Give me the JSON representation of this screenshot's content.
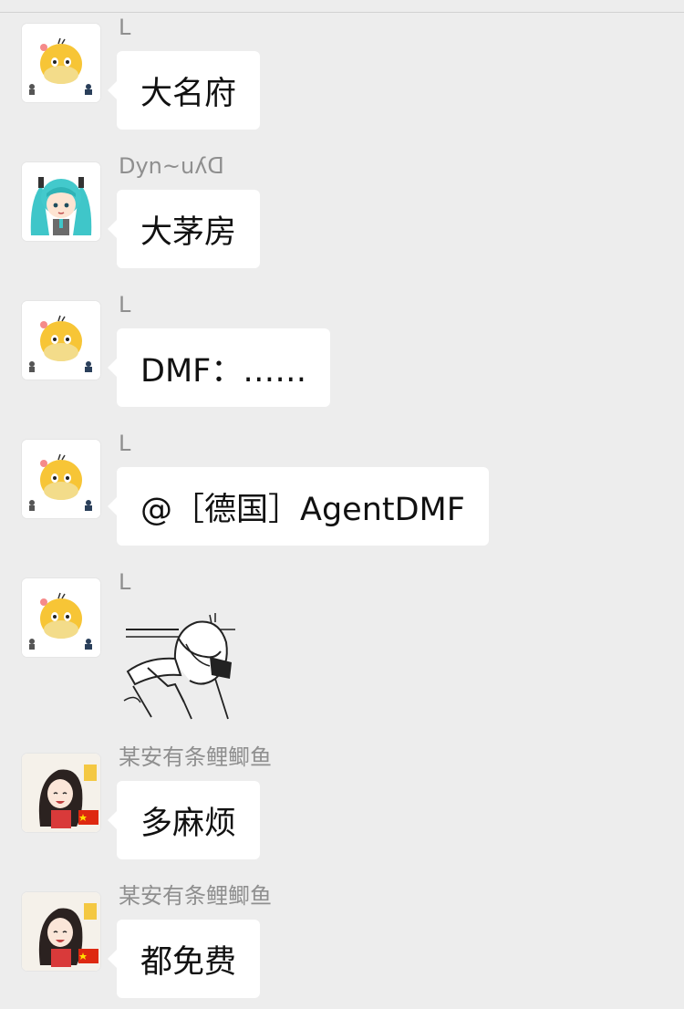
{
  "chat": {
    "messages": [
      {
        "sender": "L",
        "text": "大名府",
        "avatar": "psyduck-avatar-icon"
      },
      {
        "sender": "Dyn~uʎᗡ",
        "text": "大茅房",
        "avatar": "miku-avatar-icon"
      },
      {
        "sender": "L",
        "text": "DMF：……",
        "avatar": "psyduck-avatar-icon"
      },
      {
        "sender": "L",
        "text": "@［德国］AgentDMF",
        "avatar": "psyduck-avatar-icon"
      },
      {
        "sender": "L",
        "text": "",
        "avatar": "psyduck-avatar-icon",
        "sticker": "facepalm-sticker-icon"
      },
      {
        "sender": "某安有条鲤鲫鱼",
        "text": "多麻烦",
        "avatar": "anime-girl-avatar-icon"
      },
      {
        "sender": "某安有条鲤鲫鱼",
        "text": "都免费",
        "avatar": "anime-girl-avatar-icon"
      }
    ]
  },
  "colors": {
    "background": "#ededed",
    "bubble": "#ffffff",
    "sender_text": "#8f8f8f",
    "message_text": "#111111"
  }
}
